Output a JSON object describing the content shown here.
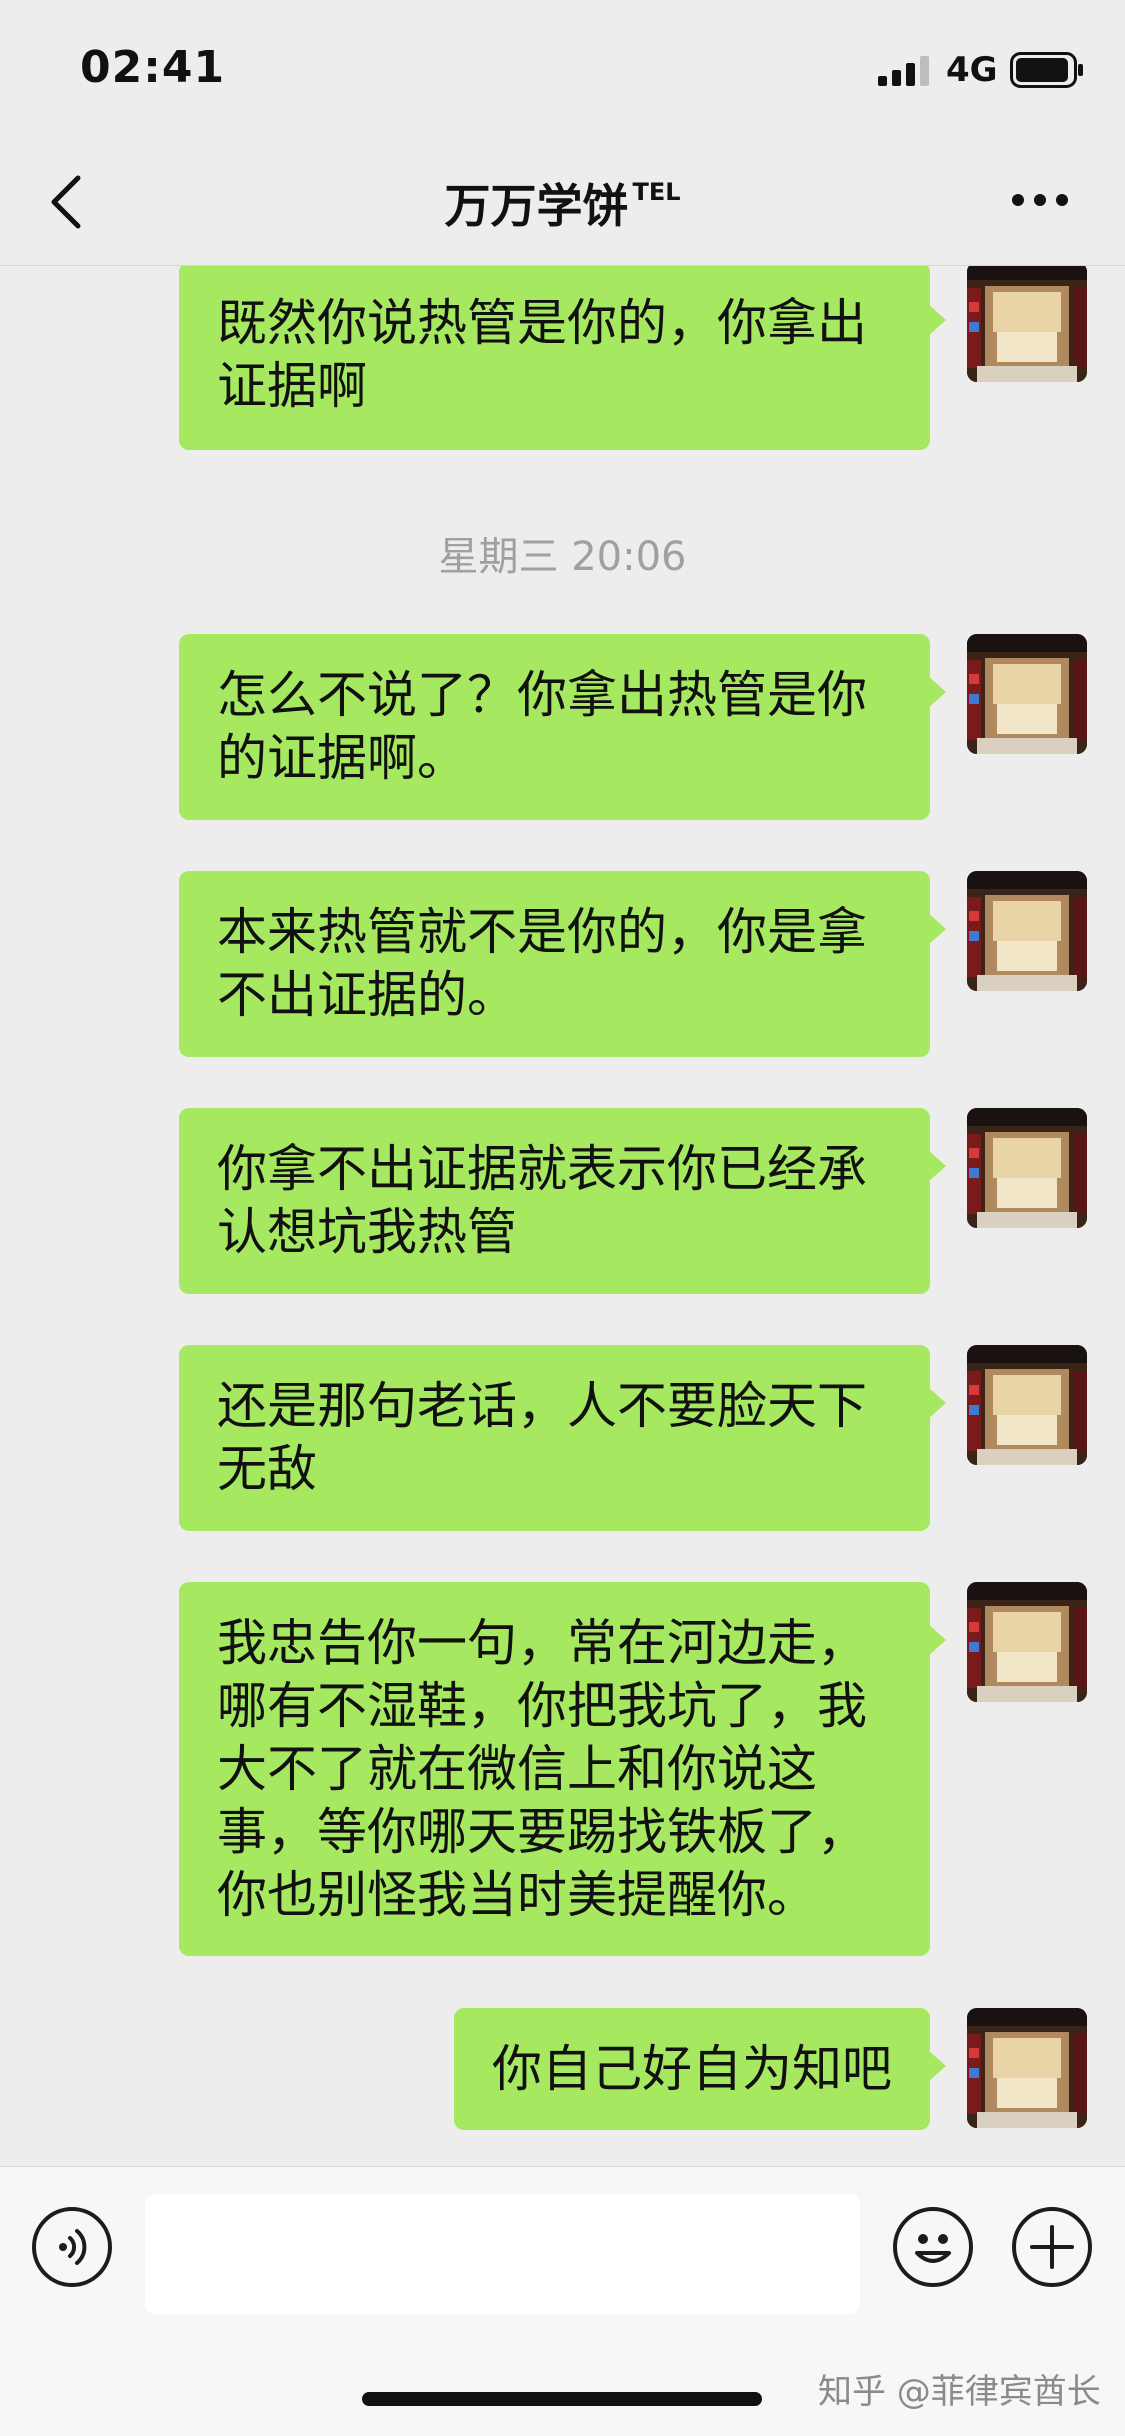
{
  "status_bar": {
    "time": "02:41",
    "network": "4G"
  },
  "nav": {
    "title": "万万学饼",
    "title_badge": "TEL"
  },
  "chat": {
    "messages": [
      {
        "lines": [
          "既然你说热管是你的，你拿出",
          "证据啊"
        ]
      },
      {
        "lines": [
          "怎么不说了？你拿出热管是你",
          "的证据啊。"
        ]
      },
      {
        "lines": [
          "本来热管就不是你的，你是拿",
          "不出证据的。"
        ]
      },
      {
        "lines": [
          "你拿不出证据就表示你已经承",
          "认想坑我热管"
        ]
      },
      {
        "lines": [
          "还是那句老话，人不要脸天下",
          "无敌"
        ]
      },
      {
        "lines": [
          "我忠告你一句，常在河边走，",
          "哪有不湿鞋，你把我坑了，我",
          "大不了就在微信上和你说这",
          "事，等你哪天要踢找铁板了，",
          "你也别怪我当时美提醒你。"
        ]
      },
      {
        "lines": [
          "你自己好自为知吧"
        ]
      }
    ],
    "timestamp": "星期三 20:06"
  },
  "watermark": "知乎 @菲律宾酋长",
  "colors": {
    "bubble": "#a6e860",
    "background": "#ededed"
  },
  "icons": [
    "back-chevron-icon",
    "more-icon",
    "voice-icon",
    "emoji-icon",
    "plus-icon",
    "signal-icon",
    "battery-icon"
  ]
}
